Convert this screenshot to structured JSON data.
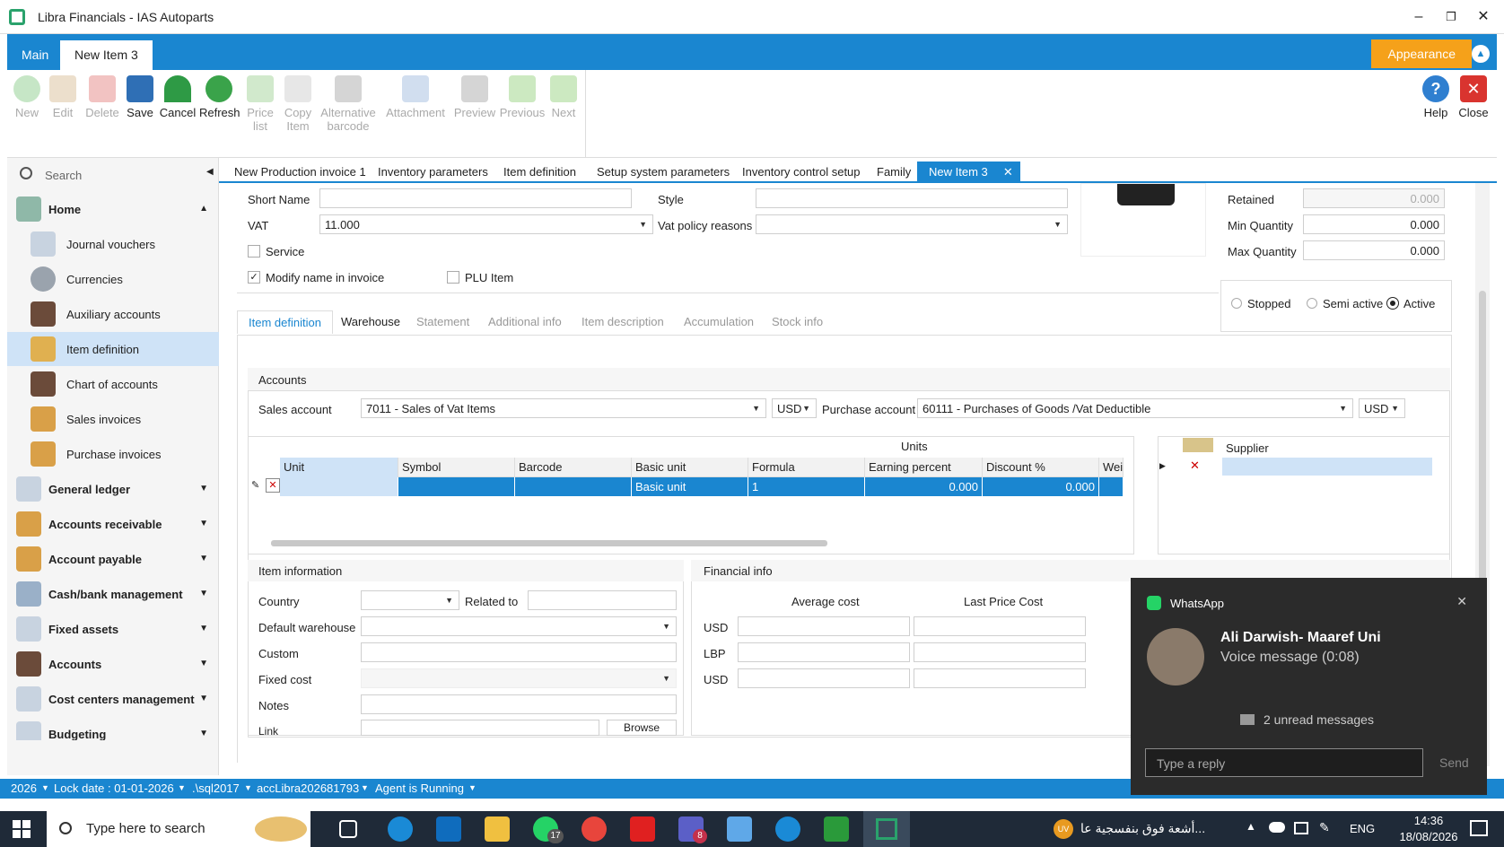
{
  "window": {
    "title": "Libra Financials - IAS Autoparts"
  },
  "ribbon": {
    "tabs": [
      "Main",
      "New Item 3"
    ],
    "appearance": "Appearance"
  },
  "toolbar": {
    "new": "New",
    "edit": "Edit",
    "delete": "Delete",
    "save": "Save",
    "cancel": "Cancel",
    "refresh": "Refresh",
    "price_list": "Price list",
    "copy_item": "Copy Item",
    "alt_barcode": "Alternative barcode",
    "attachment": "Attachment",
    "preview": "Preview",
    "previous": "Previous",
    "next": "Next",
    "help": "Help",
    "close": "Close"
  },
  "sidebar": {
    "search": "Search",
    "home": "Home",
    "items": [
      "Journal vouchers",
      "Currencies",
      "Auxiliary accounts",
      "Item definition",
      "Chart of accounts",
      "Sales invoices",
      "Purchase invoices"
    ],
    "groups": [
      "General ledger",
      "Accounts receivable",
      "Account payable",
      "Cash/bank management",
      "Fixed assets",
      "Accounts",
      "Cost centers management",
      "Budgeting"
    ]
  },
  "doc_tabs": [
    "New Production invoice 1",
    "Inventory parameters",
    "Item definition",
    "Setup system parameters",
    "Inventory control setup",
    "Family",
    "New Item 3"
  ],
  "form": {
    "short_name_label": "Short Name",
    "style_label": "Style",
    "vat_label": "VAT",
    "vat_value": "11.000",
    "vat_policy_label": "Vat policy reasons",
    "service_label": "Service",
    "modify_name_label": "Modify name in invoice",
    "plu_label": "PLU Item",
    "retained_label": "Retained",
    "retained_value": "0.000",
    "min_qty_label": "Min Quantity",
    "min_qty_value": "0.000",
    "max_qty_label": "Max Quantity",
    "max_qty_value": "0.000",
    "status": {
      "stopped": "Stopped",
      "semi": "Semi active",
      "active": "Active"
    }
  },
  "sub_tabs": [
    "Item definition",
    "Warehouse",
    "Statement",
    "Additional info",
    "Item description",
    "Accumulation",
    "Stock info"
  ],
  "accounts": {
    "title": "Accounts",
    "sales_label": "Sales account",
    "sales_value": "7011 - Sales of Vat Items",
    "sales_cur": "USD",
    "purchase_label": "Purchase account",
    "purchase_value": "60111 - Purchases of Goods /Vat Deductible",
    "purchase_cur": "USD"
  },
  "units": {
    "title": "Units",
    "headers": [
      "Unit",
      "Symbol",
      "Barcode",
      "Basic unit",
      "Formula",
      "Earning percent",
      "Discount %",
      "Weigh"
    ],
    "row": [
      "",
      "",
      "",
      "Basic unit",
      "1",
      "0.000",
      "0.000",
      ""
    ],
    "supplier": "Supplier"
  },
  "item_info": {
    "title": "Item information",
    "country": "Country",
    "related": "Related to",
    "warehouse": "Default warehouse",
    "custom": "Custom",
    "fixed_cost": "Fixed cost",
    "notes": "Notes",
    "link": "Link",
    "browse": "Browse"
  },
  "fin_info": {
    "title": "Financial info",
    "avg": "Average cost",
    "last": "Last Price Cost",
    "rows": [
      "USD",
      "LBP",
      "USD"
    ]
  },
  "statusbar": {
    "year": "2026",
    "lock": "Lock date : 01-01-2026",
    "server": ".\\sql2017",
    "db": "accLibra202681793",
    "agent": "Agent is Running"
  },
  "whatsapp": {
    "app": "WhatsApp",
    "sender": "Ali Darwish- Maaref Uni",
    "msg": "Voice message (0:08)",
    "unread": "2 unread messages",
    "placeholder": "Type a reply",
    "send": "Send"
  },
  "taskbar": {
    "search": "Type here to search",
    "news": "أشعة فوق بنفسجية عا...",
    "lang": "ENG",
    "time": "14:36",
    "date": "18/08/2026",
    "badge_whatsapp": "17",
    "badge_teams": "8",
    "uv": "UV"
  }
}
